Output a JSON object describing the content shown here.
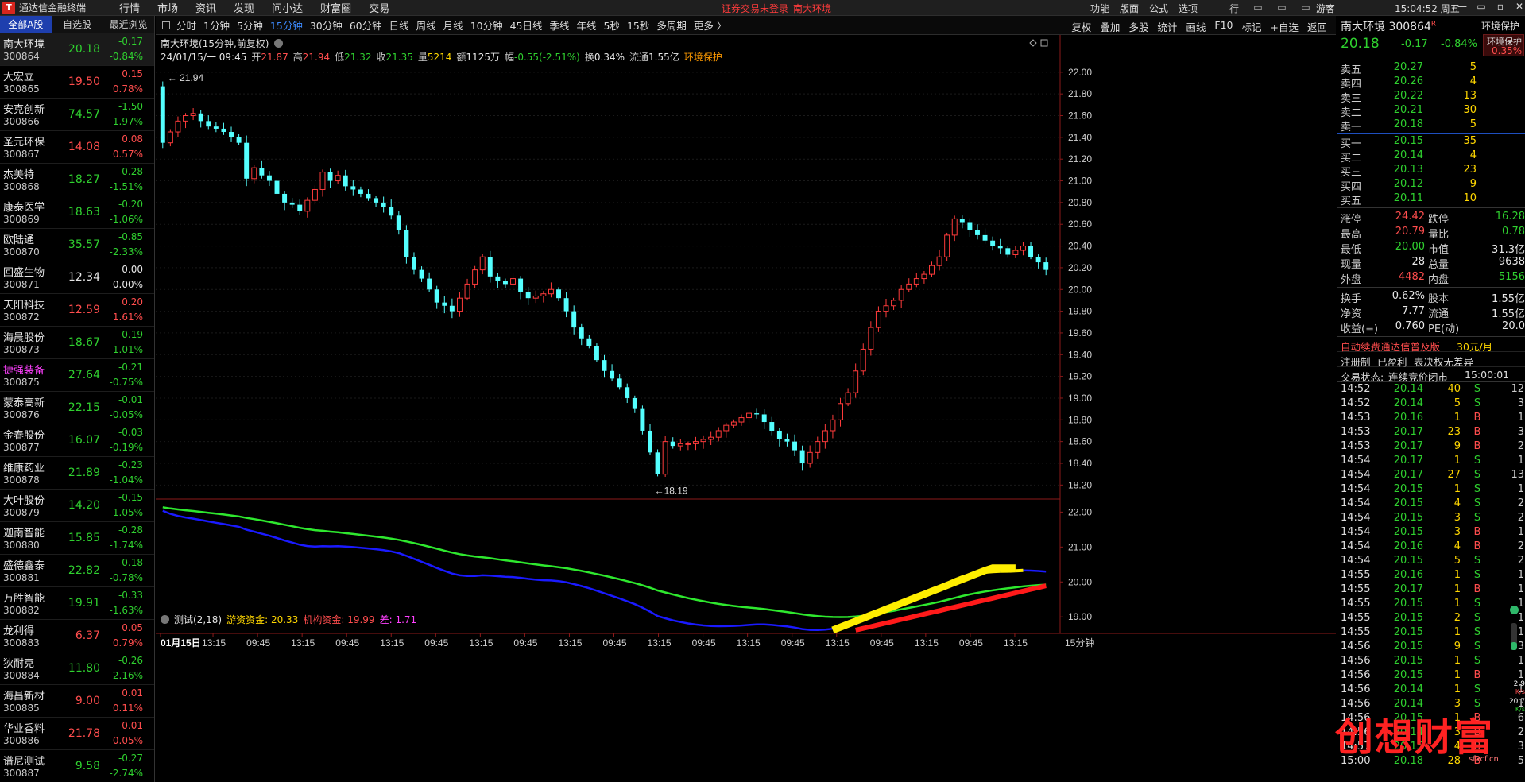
{
  "app": {
    "title": "通达信金融终端",
    "logo_letter": "T",
    "guest": "游客",
    "clock": "15:04:52 周五"
  },
  "main_menu": [
    "行情",
    "市场",
    "资讯",
    "发现",
    "问小达",
    "财富圈",
    "交易"
  ],
  "notice": {
    "login": "证券交易未登录",
    "stock": "南大环境"
  },
  "right_menu": [
    "功能",
    "版面",
    "公式",
    "选项"
  ],
  "toolbar_icons": [
    "行",
    "▭",
    "▭",
    "▭",
    "▭"
  ],
  "window_controls": [
    "—",
    "▭",
    "▫",
    "✕"
  ],
  "left_tabs": [
    "全部A股",
    "自选股",
    "最近浏览"
  ],
  "stocks": [
    {
      "name": "南大环境",
      "code": "300864",
      "price": "20.18",
      "chg": "-0.17",
      "pct": "-0.84%",
      "dir": "down",
      "sel": true
    },
    {
      "name": "大宏立",
      "code": "300865",
      "price": "19.50",
      "chg": "0.15",
      "pct": "0.78%",
      "dir": "up"
    },
    {
      "name": "安克创新",
      "code": "300866",
      "price": "74.57",
      "chg": "-1.50",
      "pct": "-1.97%",
      "dir": "down"
    },
    {
      "name": "圣元环保",
      "code": "300867",
      "price": "14.08",
      "chg": "0.08",
      "pct": "0.57%",
      "dir": "up"
    },
    {
      "name": "杰美特",
      "code": "300868",
      "price": "18.27",
      "chg": "-0.28",
      "pct": "-1.51%",
      "dir": "down"
    },
    {
      "name": "康泰医学",
      "code": "300869",
      "price": "18.63",
      "chg": "-0.20",
      "pct": "-1.06%",
      "dir": "down"
    },
    {
      "name": "欧陆通",
      "code": "300870",
      "price": "35.57",
      "chg": "-0.85",
      "pct": "-2.33%",
      "dir": "down"
    },
    {
      "name": "回盛生物",
      "code": "300871",
      "price": "12.34",
      "chg": "0.00",
      "pct": "0.00%",
      "dir": "flat"
    },
    {
      "name": "天阳科技",
      "code": "300872",
      "price": "12.59",
      "chg": "0.20",
      "pct": "1.61%",
      "dir": "up"
    },
    {
      "name": "海晨股份",
      "code": "300873",
      "price": "18.67",
      "chg": "-0.19",
      "pct": "-1.01%",
      "dir": "down"
    },
    {
      "name": "捷强装备",
      "code": "300875",
      "price": "27.64",
      "chg": "-0.21",
      "pct": "-0.75%",
      "dir": "down",
      "mag": true
    },
    {
      "name": "蒙泰高新",
      "code": "300876",
      "price": "22.15",
      "chg": "-0.01",
      "pct": "-0.05%",
      "dir": "down"
    },
    {
      "name": "金春股份",
      "code": "300877",
      "price": "16.07",
      "chg": "-0.03",
      "pct": "-0.19%",
      "dir": "down"
    },
    {
      "name": "维康药业",
      "code": "300878",
      "price": "21.89",
      "chg": "-0.23",
      "pct": "-1.04%",
      "dir": "down"
    },
    {
      "name": "大叶股份",
      "code": "300879",
      "price": "14.20",
      "chg": "-0.15",
      "pct": "-1.05%",
      "dir": "down"
    },
    {
      "name": "迦南智能",
      "code": "300880",
      "price": "15.85",
      "chg": "-0.28",
      "pct": "-1.74%",
      "dir": "down"
    },
    {
      "name": "盛德鑫泰",
      "code": "300881",
      "price": "22.82",
      "chg": "-0.18",
      "pct": "-0.78%",
      "dir": "down"
    },
    {
      "name": "万胜智能",
      "code": "300882",
      "price": "19.91",
      "chg": "-0.33",
      "pct": "-1.63%",
      "dir": "down"
    },
    {
      "name": "龙利得",
      "code": "300883",
      "price": "6.37",
      "chg": "0.05",
      "pct": "0.79%",
      "dir": "up"
    },
    {
      "name": "狄耐克",
      "code": "300884",
      "price": "11.80",
      "chg": "-0.26",
      "pct": "-2.16%",
      "dir": "down"
    },
    {
      "name": "海昌新材",
      "code": "300885",
      "price": "9.00",
      "chg": "0.01",
      "pct": "0.11%",
      "dir": "up"
    },
    {
      "name": "华业香料",
      "code": "300886",
      "price": "21.78",
      "chg": "0.01",
      "pct": "0.05%",
      "dir": "up"
    },
    {
      "name": "谱尼测试",
      "code": "300887",
      "price": "9.58",
      "chg": "-0.27",
      "pct": "-2.74%",
      "dir": "down"
    }
  ],
  "periods": {
    "items": [
      "分时",
      "1分钟",
      "5分钟",
      "15分钟",
      "30分钟",
      "60分钟",
      "日线",
      "周线",
      "月线",
      "10分钟",
      "45日线",
      "季线",
      "年线",
      "5秒",
      "15秒",
      "多周期",
      "更多 〉"
    ],
    "active": "15分钟"
  },
  "tools": [
    "复权",
    "叠加",
    "多股",
    "统计",
    "画线",
    "F10",
    "标记",
    "+自选",
    "返回"
  ],
  "chart": {
    "title": "南大环境(15分钟,前复权)",
    "date": "24/01/15/一 09:45",
    "open_label": "开",
    "open": "21.87",
    "high_label": "高",
    "high": "21.94",
    "low_label": "低",
    "low": "21.32",
    "close_label": "收",
    "close": "21.35",
    "vol_label": "量",
    "vol": "5214",
    "amt_label": "额",
    "amt": "1125万",
    "rng_label": "幅",
    "rng": "-0.55(-2.51%)",
    "turn_label": "换",
    "turn": "0.34%",
    "float_label": "流通",
    "float": "1.55亿",
    "tag": "环境保护",
    "max_label": "21.94",
    "min_label": "18.19",
    "x_first": "01月15日",
    "period_label": "15分钟"
  },
  "chart_data": {
    "type": "candlestick",
    "price_axis": {
      "ticks": [
        "22.00",
        "21.80",
        "21.60",
        "21.40",
        "21.20",
        "21.00",
        "20.80",
        "20.60",
        "20.40",
        "20.20",
        "20.00",
        "19.80",
        "19.60",
        "19.40",
        "19.20",
        "19.00",
        "18.80",
        "18.60",
        "18.40",
        "18.20"
      ],
      "min": 18.1,
      "max": 22.05
    },
    "x_ticks": [
      "01月15日",
      "13:15",
      "09:45",
      "13:15",
      "09:45",
      "13:15",
      "09:45",
      "13:15",
      "09:45",
      "13:15",
      "09:45",
      "13:15",
      "09:45",
      "13:15",
      "09:45",
      "13:15",
      "09:45",
      "13:15",
      "09:45",
      "13:15"
    ],
    "close_path": [
      21.35,
      21.45,
      21.55,
      21.6,
      21.62,
      21.55,
      21.5,
      21.48,
      21.45,
      21.4,
      21.35,
      21.02,
      21.12,
      21.05,
      21.0,
      20.88,
      20.8,
      20.78,
      20.72,
      20.82,
      20.92,
      21.08,
      21.0,
      21.05,
      20.95,
      20.92,
      20.88,
      20.84,
      20.8,
      20.76,
      20.68,
      20.55,
      20.3,
      20.18,
      20.1,
      20.0,
      19.88,
      19.85,
      19.8,
      19.92,
      20.05,
      20.18,
      20.3,
      20.12,
      20.08,
      20.05,
      20.1,
      19.98,
      19.92,
      19.94,
      19.96,
      20.0,
      19.92,
      19.8,
      19.65,
      19.55,
      19.48,
      19.35,
      19.25,
      19.18,
      19.1,
      19.0,
      18.9,
      18.7,
      18.5,
      18.3,
      18.6,
      18.56,
      18.58,
      18.58,
      18.6,
      18.62,
      18.64,
      18.7,
      18.75,
      18.78,
      18.82,
      18.86,
      18.85,
      18.78,
      18.7,
      18.62,
      18.6,
      18.52,
      18.4,
      18.5,
      18.6,
      18.7,
      18.8,
      18.95,
      19.05,
      19.25,
      19.45,
      19.65,
      19.8,
      19.85,
      19.9,
      20.0,
      20.05,
      20.1,
      20.14,
      20.22,
      20.3,
      20.5,
      20.65,
      20.62,
      20.55,
      20.5,
      20.45,
      20.4,
      20.38,
      20.32,
      20.36,
      20.4,
      20.3,
      20.25,
      20.18
    ],
    "indicator": {
      "name": "测试(2,18)",
      "lines": [
        {
          "name": "游资资金",
          "value": "20.33",
          "color": "#ffe600"
        },
        {
          "name": "机构资金",
          "value": "19.99",
          "color": "#ff2020"
        },
        {
          "name": "差",
          "value": "1.71",
          "color": "#ff40ff"
        }
      ],
      "axis_ticks": [
        "22.00",
        "21.00",
        "20.00",
        "19.00"
      ],
      "min": 18.55,
      "max": 22.35
    }
  },
  "rp": {
    "name_code": "南大环境 300864",
    "rflag": "R",
    "tag": "环境保护",
    "price": "20.18",
    "chg": "-0.17",
    "pct": "-0.84%",
    "badge": "0.35%",
    "asks": [
      {
        "l": "卖五",
        "p": "20.27",
        "v": "5"
      },
      {
        "l": "卖四",
        "p": "20.26",
        "v": "4"
      },
      {
        "l": "卖三",
        "p": "20.22",
        "v": "13"
      },
      {
        "l": "卖二",
        "p": "20.21",
        "v": "30"
      },
      {
        "l": "卖一",
        "p": "20.18",
        "v": "5"
      }
    ],
    "bids": [
      {
        "l": "买一",
        "p": "20.15",
        "v": "35"
      },
      {
        "l": "买二",
        "p": "20.14",
        "v": "4"
      },
      {
        "l": "买三",
        "p": "20.13",
        "v": "23"
      },
      {
        "l": "买四",
        "p": "20.12",
        "v": "9"
      },
      {
        "l": "买五",
        "p": "20.11",
        "v": "10"
      }
    ],
    "stats": [
      {
        "l1": "涨停",
        "v1": "24.42",
        "c1": "red",
        "l2": "跌停",
        "v2": "16.28",
        "c2": "green"
      },
      {
        "l1": "最高",
        "v1": "20.79",
        "c1": "red",
        "l2": "量比",
        "v2": "0.78",
        "c2": "green"
      },
      {
        "l1": "最低",
        "v1": "20.00",
        "c1": "green",
        "l2": "市值",
        "v2": "31.3亿",
        "c2": "white"
      },
      {
        "l1": "现量",
        "v1": "28",
        "c1": "white",
        "l2": "总量",
        "v2": "9638",
        "c2": "white"
      },
      {
        "l1": "外盘",
        "v1": "4482",
        "c1": "red",
        "l2": "内盘",
        "v2": "5156",
        "c2": "green"
      }
    ],
    "stats2": [
      {
        "l1": "换手",
        "v1": "0.62%",
        "c1": "white",
        "l2": "股本",
        "v2": "1.55亿",
        "c2": "white"
      },
      {
        "l1": "净资",
        "v1": "7.77",
        "c1": "white",
        "l2": "流通",
        "v2": "1.55亿",
        "c2": "white"
      },
      {
        "l1": "收益(≡)",
        "v1": "0.760",
        "c1": "white",
        "l2": "PE(动)",
        "v2": "20.0",
        "c2": "white"
      }
    ],
    "promo_a": "自动续费通达信普及版",
    "promo_b": "30元/月",
    "reg_a": "注册制",
    "reg_b": "已盈利",
    "reg_c": "表决权无差异",
    "state_a": "交易状态:",
    "state_b": "连续竞价闭市",
    "state_c": "15:00:01",
    "ticks": [
      {
        "t": "14:52",
        "p": "20.14",
        "v": "40",
        "bs": "S",
        "n": "12"
      },
      {
        "t": "14:52",
        "p": "20.14",
        "v": "5",
        "bs": "S",
        "n": "3"
      },
      {
        "t": "14:53",
        "p": "20.16",
        "v": "1",
        "bs": "B",
        "n": "1"
      },
      {
        "t": "14:53",
        "p": "20.17",
        "v": "23",
        "bs": "B",
        "n": "3"
      },
      {
        "t": "14:53",
        "p": "20.17",
        "v": "9",
        "bs": "B",
        "n": "2"
      },
      {
        "t": "14:54",
        "p": "20.17",
        "v": "1",
        "bs": "S",
        "n": "1"
      },
      {
        "t": "14:54",
        "p": "20.17",
        "v": "27",
        "bs": "S",
        "n": "13"
      },
      {
        "t": "14:54",
        "p": "20.15",
        "v": "1",
        "bs": "S",
        "n": "1"
      },
      {
        "t": "14:54",
        "p": "20.15",
        "v": "4",
        "bs": "S",
        "n": "2"
      },
      {
        "t": "14:54",
        "p": "20.15",
        "v": "3",
        "bs": "S",
        "n": "2"
      },
      {
        "t": "14:54",
        "p": "20.15",
        "v": "3",
        "bs": "B",
        "n": "1"
      },
      {
        "t": "14:54",
        "p": "20.16",
        "v": "4",
        "bs": "B",
        "n": "2"
      },
      {
        "t": "14:54",
        "p": "20.15",
        "v": "5",
        "bs": "S",
        "n": "2"
      },
      {
        "t": "14:55",
        "p": "20.16",
        "v": "1",
        "bs": "S",
        "n": "1"
      },
      {
        "t": "14:55",
        "p": "20.17",
        "v": "1",
        "bs": "B",
        "n": "1"
      },
      {
        "t": "14:55",
        "p": "20.15",
        "v": "1",
        "bs": "S",
        "n": "1"
      },
      {
        "t": "14:55",
        "p": "20.15",
        "v": "2",
        "bs": "S",
        "n": "1"
      },
      {
        "t": "14:55",
        "p": "20.15",
        "v": "1",
        "bs": "S",
        "n": "1"
      },
      {
        "t": "14:56",
        "p": "20.15",
        "v": "9",
        "bs": "S",
        "n": "3"
      },
      {
        "t": "14:56",
        "p": "20.15",
        "v": "1",
        "bs": "S",
        "n": "1"
      },
      {
        "t": "14:56",
        "p": "20.15",
        "v": "1",
        "bs": "B",
        "n": "1"
      },
      {
        "t": "14:56",
        "p": "20.14",
        "v": "1",
        "bs": "S",
        "n": "1"
      },
      {
        "t": "14:56",
        "p": "20.14",
        "v": "3",
        "bs": "S",
        "n": "1"
      },
      {
        "t": "14:56",
        "p": "20.15",
        "v": "1",
        "bs": "B",
        "n": "6"
      },
      {
        "t": "14:56",
        "p": "20.14",
        "v": "3",
        "bs": "B",
        "n": "2"
      },
      {
        "t": "14:57",
        "p": "20.15",
        "v": "4",
        "bs": "B",
        "n": "3"
      },
      {
        "t": "15:00",
        "p": "20.18",
        "v": "28",
        "bs": "B",
        "n": "5"
      }
    ],
    "gauge_a": "2.9",
    "gauge_a_unit": "K/s",
    "gauge_b": "20.7",
    "gauge_b_unit": "K/s"
  },
  "watermark": {
    "text": "创想财富",
    "sub": "sfxcf.cn"
  }
}
